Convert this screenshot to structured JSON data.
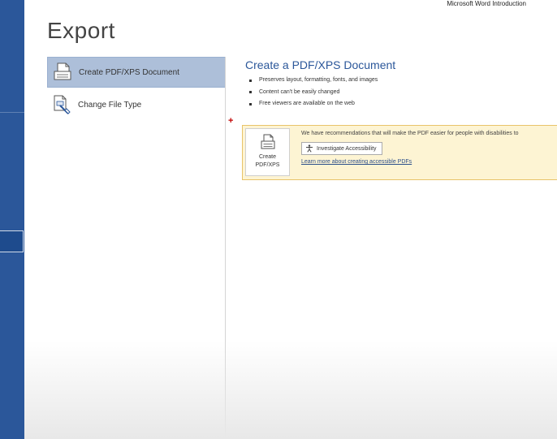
{
  "window": {
    "title": "Microsoft Word Introduction"
  },
  "page": {
    "title": "Export"
  },
  "nav": {
    "items": [
      {
        "label": "Create PDF/XPS Document",
        "icon": "pdf-document-icon",
        "active": true
      },
      {
        "label": "Change File Type",
        "icon": "change-file-type-icon",
        "active": false
      }
    ]
  },
  "detail": {
    "title": "Create a PDF/XPS Document",
    "bullets": [
      "Preserves layout, formatting, fonts, and images",
      "Content can't be easily changed",
      "Free viewers are available on the web"
    ],
    "create_button": {
      "line1": "Create",
      "line2": "PDF/XPS"
    },
    "notice": {
      "text": "We have recommendations that will make the PDF easier for people with disabilities to",
      "investigate_label": "Investigate Accessibility",
      "link_text": "Learn more about creating accessible PDFs"
    }
  },
  "colors": {
    "rail": "#2b579a",
    "accent_title": "#2b579a",
    "active_item": "#adbfd9",
    "notice_bg": "#fdf4d3",
    "notice_border": "#e8c36a"
  }
}
